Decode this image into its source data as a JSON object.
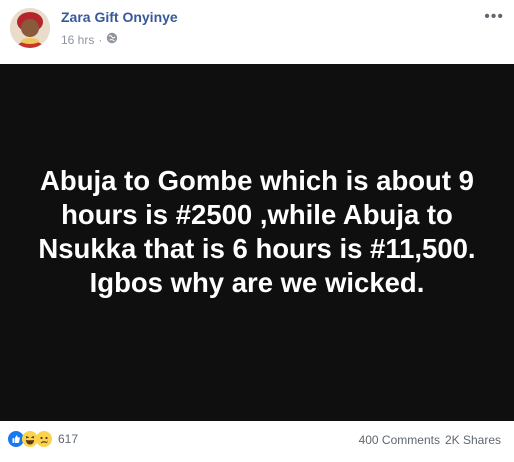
{
  "header": {
    "author": "Zara Gift Onyinye",
    "time": "16 hrs",
    "separator": "·",
    "audience_icon": "globe-icon",
    "more_icon": "more-options-icon",
    "more_label": "•••"
  },
  "post": {
    "text": "Abuja to Gombe which is about 9 hours is #2500 ,while Abuja to Nsukka that is 6 hours is #11,500. Igbos why are we wicked.",
    "background_color": "#0f0f10",
    "text_color": "#ffffff"
  },
  "footer": {
    "reaction_icons": [
      "like-icon",
      "haha-icon",
      "sad-icon"
    ],
    "reaction_count": "617",
    "comments": "400 Comments",
    "shares": "2K Shares"
  },
  "colors": {
    "link": "#385898",
    "meta": "#90949c",
    "like": "#1877f2",
    "emoji": "#fcd34d"
  }
}
